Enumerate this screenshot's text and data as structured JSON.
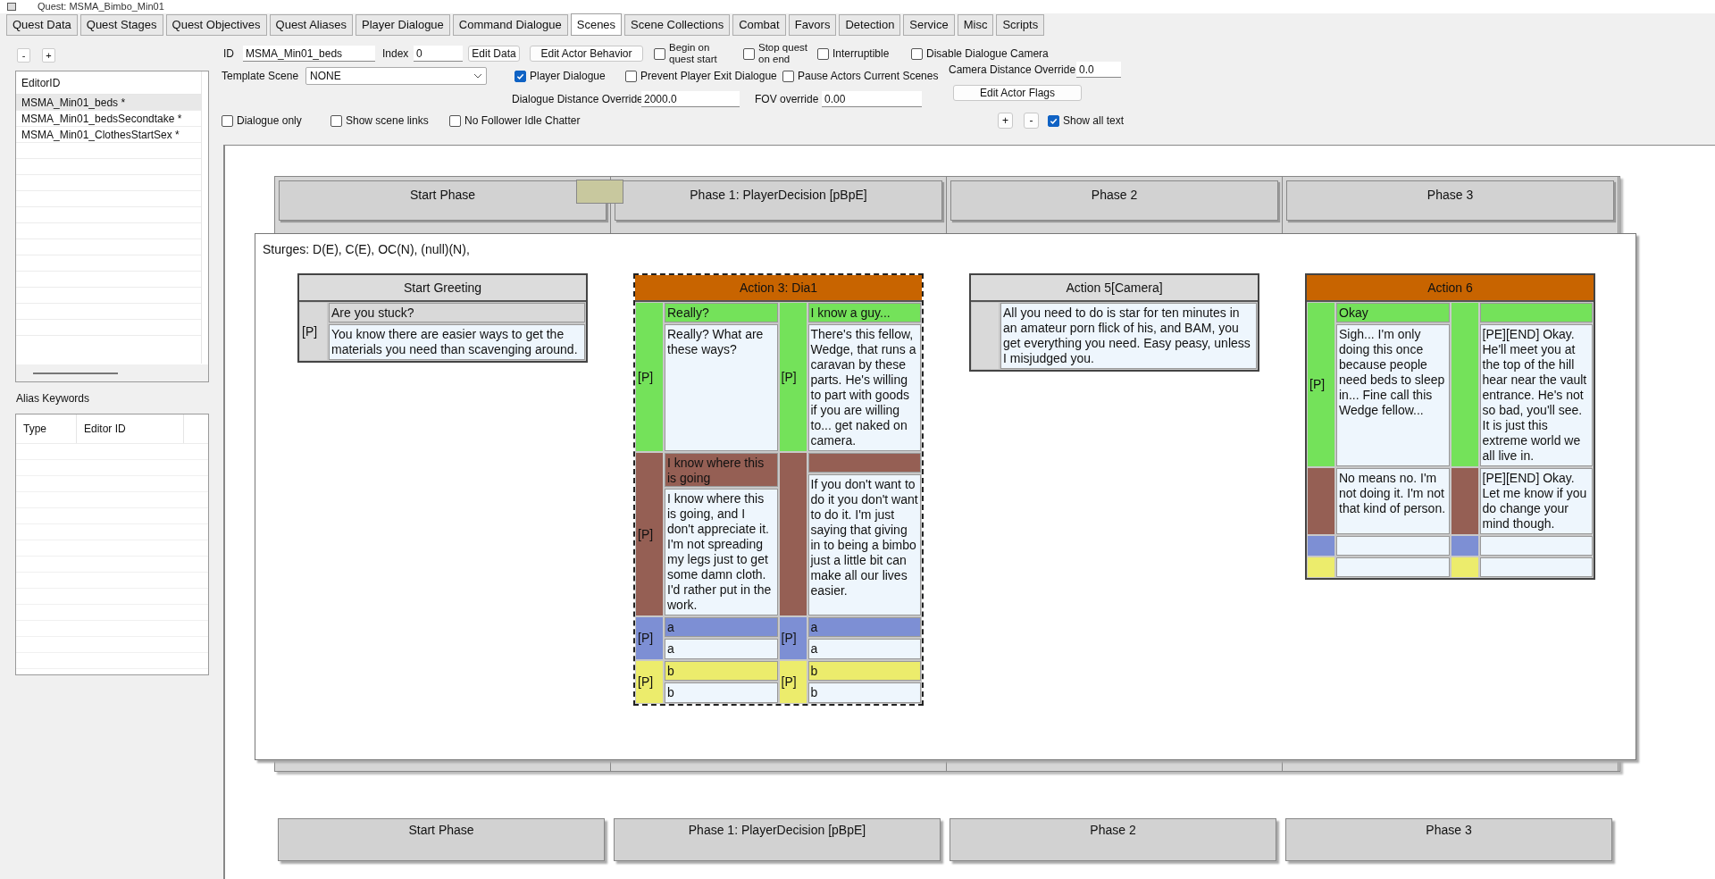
{
  "window": {
    "title": "Quest: MSMA_Bimbo_Min01"
  },
  "tabs": [
    {
      "label": "Quest Data",
      "selected": false
    },
    {
      "label": "Quest Stages",
      "selected": false
    },
    {
      "label": "Quest Objectives",
      "selected": false
    },
    {
      "label": "Quest Aliases",
      "selected": false
    },
    {
      "label": "Player Dialogue",
      "selected": false
    },
    {
      "label": "Command Dialogue",
      "selected": false
    },
    {
      "label": "Scenes",
      "selected": true
    },
    {
      "label": "Scene Collections",
      "selected": false
    },
    {
      "label": "Combat",
      "selected": false
    },
    {
      "label": "Favors",
      "selected": false
    },
    {
      "label": "Detection",
      "selected": false
    },
    {
      "label": "Service",
      "selected": false
    },
    {
      "label": "Misc",
      "selected": false
    },
    {
      "label": "Scripts",
      "selected": false
    }
  ],
  "scene_list": {
    "remove_button": "-",
    "add_button": "+",
    "column": "EditorID",
    "rows": [
      {
        "label": "MSMA_Min01_beds *",
        "selected": true
      },
      {
        "label": "MSMA_Min01_bedsSecondtake *",
        "selected": false
      },
      {
        "label": "MSMA_Min01_ClothesStartSex *",
        "selected": false
      }
    ]
  },
  "alias_keywords": {
    "title": "Alias Keywords",
    "columns": [
      "Type",
      "Editor ID"
    ]
  },
  "scene_form": {
    "id": {
      "label": "ID",
      "value": "MSMA_Min01_beds"
    },
    "index": {
      "label": "Index",
      "value": "0"
    },
    "edit_data_button": "Edit Data",
    "edit_actor_behavior_button": "Edit Actor Behavior",
    "begin_on_quest_start": {
      "label": "Begin on quest start",
      "checked": false
    },
    "stop_quest_on_end": {
      "label": "Stop quest on end",
      "checked": false
    },
    "interruptible": {
      "label": "Interruptible",
      "checked": false
    },
    "disable_dialogue_camera": {
      "label": "Disable Dialogue Camera",
      "checked": false
    },
    "template_scene": {
      "label": "Template Scene",
      "value": "NONE"
    },
    "player_dialogue": {
      "label": "Player Dialogue",
      "checked": true
    },
    "prevent_player_exit_dialogue": {
      "label": "Prevent Player Exit Dialogue",
      "checked": false
    },
    "pause_actors_current_scenes": {
      "label": "Pause Actors Current Scenes",
      "checked": false
    },
    "camera_distance_override": {
      "label": "Camera Distance Override",
      "value": "0.0"
    },
    "dialogue_distance_override": {
      "label": "Dialogue Distance Override",
      "value": "2000.0"
    },
    "fov_override": {
      "label": "FOV override",
      "value": "0.00"
    },
    "edit_actor_flags_button": "Edit Actor Flags",
    "dialogue_only": {
      "label": "Dialogue only",
      "checked": false
    },
    "show_scene_links": {
      "label": "Show scene links",
      "checked": false
    },
    "no_follower_idle_chatter": {
      "label": "No Follower Idle Chatter",
      "checked": false
    },
    "zoom_in_button": "+",
    "zoom_out_button": "-",
    "show_all_text": {
      "label": "Show all text",
      "checked": true
    }
  },
  "scene_canvas": {
    "phases": [
      "Start Phase",
      "Phase 1: PlayerDecision [pBpE]",
      "Phase 2",
      "Phase 3"
    ],
    "phase_footer": [
      "Start Phase",
      "Phase 1: PlayerDecision [pBpE]",
      "Phase 2",
      "Phase 3"
    ],
    "actors_line": "Sturges: D(E), C(E), OC(N), (null)(N),",
    "actions": [
      {
        "title": "Start Greeting",
        "kind": "single",
        "selected": false,
        "rows": [
          {
            "color": "#d9d9d9",
            "has_prompt": true,
            "branches": [
              {
                "marker": "[P]",
                "prompt": "Are you stuck?",
                "response": "You know there are easier ways to get the materials you need than scavenging around."
              }
            ]
          }
        ]
      },
      {
        "title": "Action 3: Dia1",
        "kind": "dialogue",
        "selected": true,
        "rows": [
          {
            "color": "#74e25a",
            "has_prompt": true,
            "branches": [
              {
                "marker": "[P]",
                "prompt": "Really?",
                "response": "Really? What are these ways?"
              },
              {
                "marker": "[P]",
                "prompt": "I know a guy...",
                "response": "There's this fellow, Wedge, that runs a caravan by these parts. He's willing to part with goods if you are willing to... get naked on camera."
              }
            ]
          },
          {
            "color": "#955f54",
            "has_prompt": true,
            "branches": [
              {
                "marker": "[P]",
                "prompt": "I know where this is going",
                "response": "I know where this is going, and I don't appreciate it. I'm not spreading my legs just to get some damn cloth. I'd rather put in the work."
              },
              {
                "response": "If you don't want to do it you don't want to do it. I'm just saying that giving in to being a bimbo just a little bit can make all our lives easier."
              }
            ]
          },
          {
            "color": "#7d8fd4",
            "has_prompt": true,
            "branches": [
              {
                "marker": "[P]",
                "prompt": "a",
                "response": "a"
              },
              {
                "marker": "[P]",
                "prompt": "a",
                "response": "a"
              }
            ]
          },
          {
            "color": "#ecec6c",
            "has_prompt": true,
            "branches": [
              {
                "marker": "[P]",
                "prompt": "b",
                "response": "b"
              },
              {
                "marker": "[P]",
                "prompt": "b",
                "response": "b"
              }
            ]
          }
        ]
      },
      {
        "title": "Action 5[Camera]",
        "kind": "single",
        "selected": false,
        "rows": [
          {
            "color": "#d9d9d9",
            "has_prompt": false,
            "branches": [
              {
                "response": "All you need to do is star for ten minutes in an amateur porn flick of his, and BAM, you get everything you need. Easy peasy, unless I misjudged you."
              }
            ]
          }
        ]
      },
      {
        "title": "Action 6",
        "kind": "dialogue",
        "selected": false,
        "rows": [
          {
            "color": "#74e25a",
            "has_prompt": true,
            "branches": [
              {
                "marker": "[P]",
                "prompt": "Okay",
                "response": "Sigh... I'm only doing this once because people need beds to sleep in... Fine call this Wedge fellow..."
              },
              {
                "response": "[PE][END] Okay. He'll meet you at the top of the hill hear near the vault entrance. He's not so bad, you'll see. It is just this extreme world we all live in."
              }
            ]
          },
          {
            "color": "#955f54",
            "has_prompt": false,
            "branches": [
              {
                "response": "No means no. I'm not doing it. I'm not that kind of person."
              },
              {
                "response": "[PE][END] Okay. Let me know if you do change your mind though."
              }
            ]
          },
          {
            "color": "#7d8fd4",
            "has_prompt": false
          },
          {
            "color": "#ecec6c",
            "has_prompt": false
          }
        ]
      }
    ]
  }
}
